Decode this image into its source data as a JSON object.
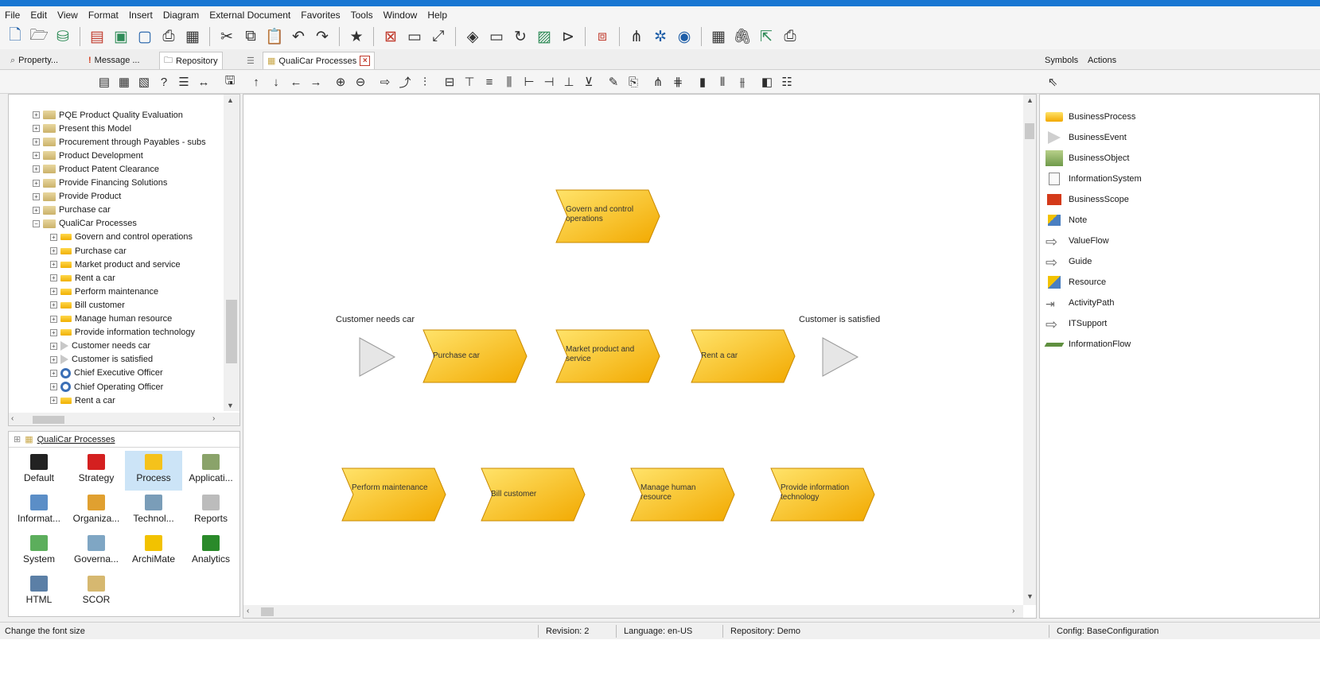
{
  "menu": [
    "File",
    "Edit",
    "View",
    "Format",
    "Insert",
    "Diagram",
    "External Document",
    "Favorites",
    "Tools",
    "Window",
    "Help"
  ],
  "tabs": {
    "property": "Property...",
    "message": "Message ...",
    "repository": "Repository",
    "diagram": "QualiCar Processes"
  },
  "symbol_tabs": {
    "symbols": "Symbols",
    "actions": "Actions"
  },
  "tree": [
    {
      "label": "PQE Product Quality Evaluation",
      "type": "folder",
      "indent": 0
    },
    {
      "label": "Present this Model",
      "type": "folder",
      "indent": 0
    },
    {
      "label": "Procurement through Payables - subs",
      "type": "folder",
      "indent": 0
    },
    {
      "label": "Product Development",
      "type": "folder",
      "indent": 0
    },
    {
      "label": "Product Patent Clearance",
      "type": "folder",
      "indent": 0
    },
    {
      "label": "Provide Financing Solutions",
      "type": "folder",
      "indent": 0
    },
    {
      "label": "Provide Product",
      "type": "folder",
      "indent": 0
    },
    {
      "label": "Purchase car",
      "type": "folder",
      "indent": 0
    },
    {
      "label": "QualiCar Processes",
      "type": "folder",
      "indent": 0,
      "expanded": true
    },
    {
      "label": "Govern and control operations",
      "type": "process",
      "indent": 1
    },
    {
      "label": "Purchase car",
      "type": "process",
      "indent": 1
    },
    {
      "label": "Market product and service",
      "type": "process",
      "indent": 1
    },
    {
      "label": "Rent a car",
      "type": "process",
      "indent": 1
    },
    {
      "label": "Perform maintenance",
      "type": "process",
      "indent": 1
    },
    {
      "label": "Bill customer",
      "type": "process",
      "indent": 1
    },
    {
      "label": "Manage human resource",
      "type": "process",
      "indent": 1
    },
    {
      "label": "Provide information technology",
      "type": "process",
      "indent": 1
    },
    {
      "label": "Customer needs car",
      "type": "event",
      "indent": 1
    },
    {
      "label": "Customer is satisfied",
      "type": "event",
      "indent": 1
    },
    {
      "label": "Chief Executive Officer",
      "type": "role",
      "indent": 1
    },
    {
      "label": "Chief Operating Officer",
      "type": "role",
      "indent": 1
    },
    {
      "label": "Rent a car",
      "type": "process",
      "indent": 1
    }
  ],
  "views_header": "QualiCar Processes",
  "views": [
    {
      "label": "Default",
      "icon": "folder-icon",
      "color": "#222222"
    },
    {
      "label": "Strategy",
      "icon": "strategy-icon",
      "color": "#d42020"
    },
    {
      "label": "Process",
      "icon": "process-icon",
      "color": "#f5c21b",
      "selected": true
    },
    {
      "label": "Applicati...",
      "icon": "application-icon",
      "color": "#8aa36a"
    },
    {
      "label": "Informat...",
      "icon": "information-icon",
      "color": "#5b8ec7"
    },
    {
      "label": "Organiza...",
      "icon": "organization-icon",
      "color": "#e0a030"
    },
    {
      "label": "Technol...",
      "icon": "technology-icon",
      "color": "#7a9db8"
    },
    {
      "label": "Reports",
      "icon": "reports-icon",
      "color": "#bcbcbc"
    },
    {
      "label": "System",
      "icon": "system-icon",
      "color": "#5cae5c"
    },
    {
      "label": "Governa...",
      "icon": "governance-icon",
      "color": "#7fa6c4"
    },
    {
      "label": "ArchiMate",
      "icon": "archimate-icon",
      "color": "#f2c200"
    },
    {
      "label": "Analytics",
      "icon": "analytics-icon",
      "color": "#2a8a2a"
    },
    {
      "label": "HTML",
      "icon": "html-icon",
      "color": "#5b7fa6"
    },
    {
      "label": "SCOR",
      "icon": "scor-icon",
      "color": "#d6b870"
    }
  ],
  "diagram": {
    "processes": [
      {
        "label": "Govern and control operations"
      },
      {
        "label": "Purchase car"
      },
      {
        "label": "Market product and service"
      },
      {
        "label": "Rent a car"
      },
      {
        "label": "Perform maintenance"
      },
      {
        "label": "Bill customer"
      },
      {
        "label": "Manage human resource"
      },
      {
        "label": "Provide information technology"
      }
    ],
    "events": [
      {
        "label": "Customer needs car"
      },
      {
        "label": "Customer is satisfied"
      }
    ],
    "colors": {
      "process_top": "#ffe36a",
      "process_bottom": "#f2a900",
      "event": "#e6e6e6"
    }
  },
  "symbols": [
    {
      "label": "BusinessProcess",
      "icon": "business-process-icon"
    },
    {
      "label": "BusinessEvent",
      "icon": "business-event-icon"
    },
    {
      "label": "BusinessObject",
      "icon": "business-object-icon"
    },
    {
      "label": "InformationSystem",
      "icon": "information-system-icon"
    },
    {
      "label": "BusinessScope",
      "icon": "business-scope-icon"
    },
    {
      "label": "Note",
      "icon": "note-icon"
    },
    {
      "label": "ValueFlow",
      "icon": "value-flow-icon"
    },
    {
      "label": "Guide",
      "icon": "guide-icon"
    },
    {
      "label": "Resource",
      "icon": "resource-icon"
    },
    {
      "label": "ActivityPath",
      "icon": "activity-path-icon"
    },
    {
      "label": "ITSupport",
      "icon": "it-support-icon"
    },
    {
      "label": "InformationFlow",
      "icon": "information-flow-icon"
    }
  ],
  "status": {
    "hint": "Change the font size",
    "revision": "Revision: 2",
    "language": "Language: en-US",
    "repository": "Repository: Demo",
    "config": "Config: BaseConfiguration"
  }
}
